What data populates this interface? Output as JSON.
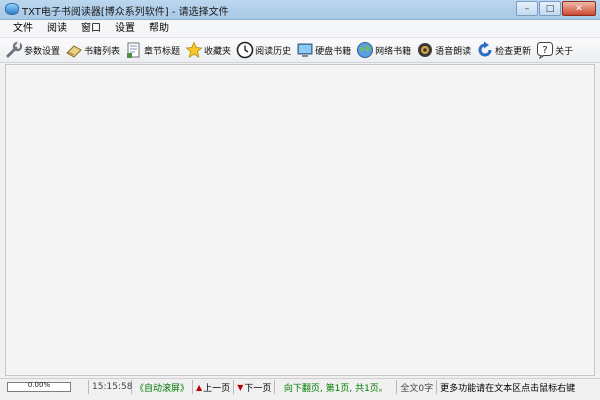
{
  "window": {
    "title": "TXT电子书阅读器[博众系列软件] - 请选择文件",
    "controls": {
      "minimize": "–",
      "maximize": "□",
      "close": "✕"
    }
  },
  "menubar": {
    "items": [
      {
        "label": "文件"
      },
      {
        "label": "阅读"
      },
      {
        "label": "窗口"
      },
      {
        "label": "设置"
      },
      {
        "label": "帮助"
      }
    ]
  },
  "toolbar": {
    "items": [
      {
        "label": "参数设置",
        "icon": "wrench-icon"
      },
      {
        "label": "书籍列表",
        "icon": "book-list-icon"
      },
      {
        "label": "章节标题",
        "icon": "chapter-icon"
      },
      {
        "label": "收藏夹",
        "icon": "star-icon"
      },
      {
        "label": "阅读历史",
        "icon": "clock-icon"
      },
      {
        "label": "硬盘书籍",
        "icon": "monitor-icon"
      },
      {
        "label": "网络书籍",
        "icon": "globe-icon"
      },
      {
        "label": "语音朗读",
        "icon": "speaker-icon"
      },
      {
        "label": "检查更新",
        "icon": "refresh-icon"
      },
      {
        "label": "关于",
        "icon": "help-icon"
      }
    ]
  },
  "status": {
    "progress_text": "0.00%",
    "progress_value": 0,
    "time": "15:15:58",
    "auto_scroll": "《自动滚屏》",
    "prev_page": "上一页",
    "next_page": "下一页",
    "page_info": "向下翻页, 第1页, 共1页。",
    "total_chars": "全文0字",
    "hint": "更多功能请在文本区点击鼠标右键"
  },
  "colors": {
    "green_text": "#007a00",
    "red_arrow": "#c00000",
    "progress_fill": "#3fae49"
  }
}
